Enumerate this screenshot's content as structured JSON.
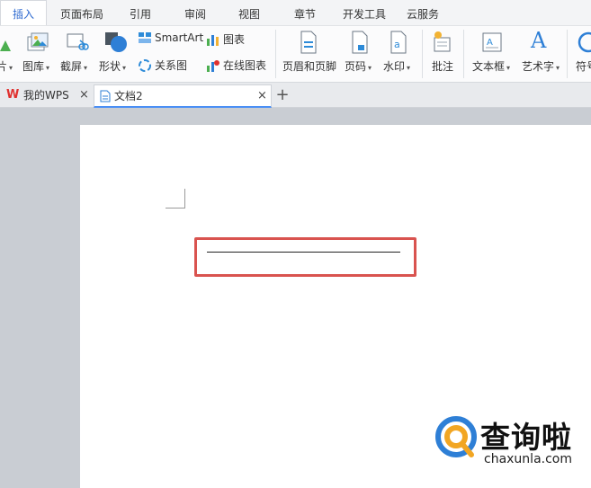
{
  "menu_tabs": [
    "插入",
    "页面布局",
    "引用",
    "审阅",
    "视图",
    "章节",
    "开发工具",
    "云服务"
  ],
  "ribbon": {
    "partial_left_label": "片",
    "gallery": "图库",
    "screenshot": "截屏",
    "shapes": "形状",
    "smartart": "SmartArt",
    "chart": "图表",
    "relation_chart": "关系图",
    "online_chart": "在线图表",
    "header_footer": "页眉和页脚",
    "page_number": "页码",
    "watermark": "水印",
    "comment": "批注",
    "textbox": "文本框",
    "wordart": "艺术字",
    "symbol": "符号"
  },
  "tabs": {
    "my_wps": "我的WPS",
    "doc2": "文档2",
    "close_glyph": "×",
    "new_glyph": "+"
  },
  "watermark": {
    "title": "查询啦",
    "url": "chaxunla.com"
  },
  "colors": {
    "accent": "#2f6bd0",
    "highlight_border": "#d9534f",
    "wps_red": "#e0312f",
    "workspace_bg": "#c9cdd3"
  },
  "icons": [
    "picture-icon",
    "gallery-icon",
    "screenshot-icon",
    "shapes-icon",
    "smartart-icon",
    "chart-icon",
    "relation-chart-icon",
    "online-chart-icon",
    "header-footer-icon",
    "page-number-icon",
    "watermark-icon",
    "comment-icon",
    "textbox-icon",
    "wordart-icon",
    "symbol-icon",
    "wps-logo-icon",
    "document-icon",
    "close-icon",
    "plus-icon"
  ]
}
